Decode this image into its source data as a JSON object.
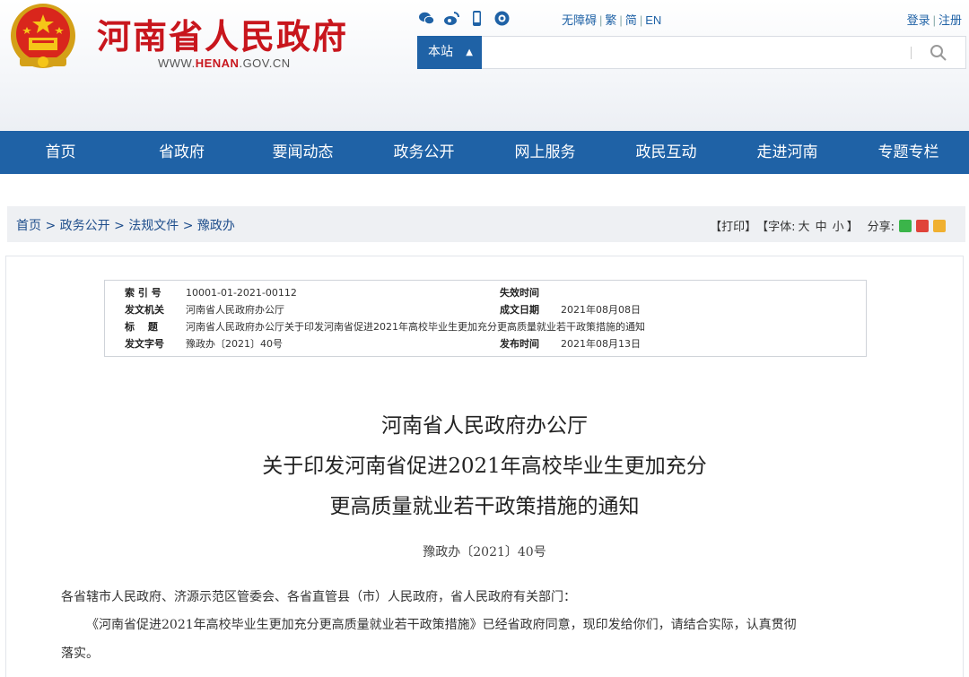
{
  "header": {
    "site_title": "河南省人民政府",
    "url_prefix": "WWW.",
    "url_domain": "HENAN",
    "url_suffix": ".GOV.CN",
    "social_icons": [
      "wechat-icon",
      "weibo-icon",
      "mobile-icon",
      "app-icon"
    ],
    "accessibility_links": [
      "无障碍",
      "繁",
      "简",
      "EN"
    ],
    "login": "登录",
    "register": "注册",
    "search": {
      "scope": "本站",
      "placeholder": ""
    }
  },
  "nav": [
    "首页",
    "省政府",
    "要闻动态",
    "政务公开",
    "网上服务",
    "政民互动",
    "走进河南",
    "专题专栏"
  ],
  "breadcrumb": "首页 > 政务公开 > 法规文件 > 豫政办",
  "tools": {
    "print": "【打印】",
    "font_label": "【字体: ",
    "font_sizes": [
      "大",
      "中",
      "小"
    ],
    "font_close": "】",
    "share": "分享:"
  },
  "meta": {
    "index_label": "索 引 号",
    "index": "10001-01-2021-00112",
    "expire_label": "失效时间",
    "expire": "",
    "issuer_label": "发文机关",
    "issuer": "河南省人民政府办公厅",
    "created_label": "成文日期",
    "created": "2021年08月08日",
    "title_label": "标　 题",
    "title": "河南省人民政府办公厅关于印发河南省促进2021年高校毕业生更加充分更高质量就业若干政策措施的通知",
    "docno_label": "发文字号",
    "docno": "豫政办〔2021〕40号",
    "published_label": "发布时间",
    "published": "2021年08月13日"
  },
  "document": {
    "title_line1": "河南省人民政府办公厅",
    "title_line2": "关于印发河南省促进2021年高校毕业生更加充分",
    "title_line3": "更高质量就业若干政策措施的通知",
    "doc_number": "豫政办〔2021〕40号",
    "addressee": "各省辖市人民政府、济源示范区管委会、各省直管县（市）人民政府，省人民政府有关部门：",
    "body_line1": "《河南省促进2021年高校毕业生更加充分更高质量就业若干政策措施》已经省政府同意，现印发给你们，请结合实际，认真贯彻",
    "body_line2": "落实。"
  },
  "colors": {
    "brand_red": "#c8161d",
    "nav_blue": "#1f62a6"
  }
}
